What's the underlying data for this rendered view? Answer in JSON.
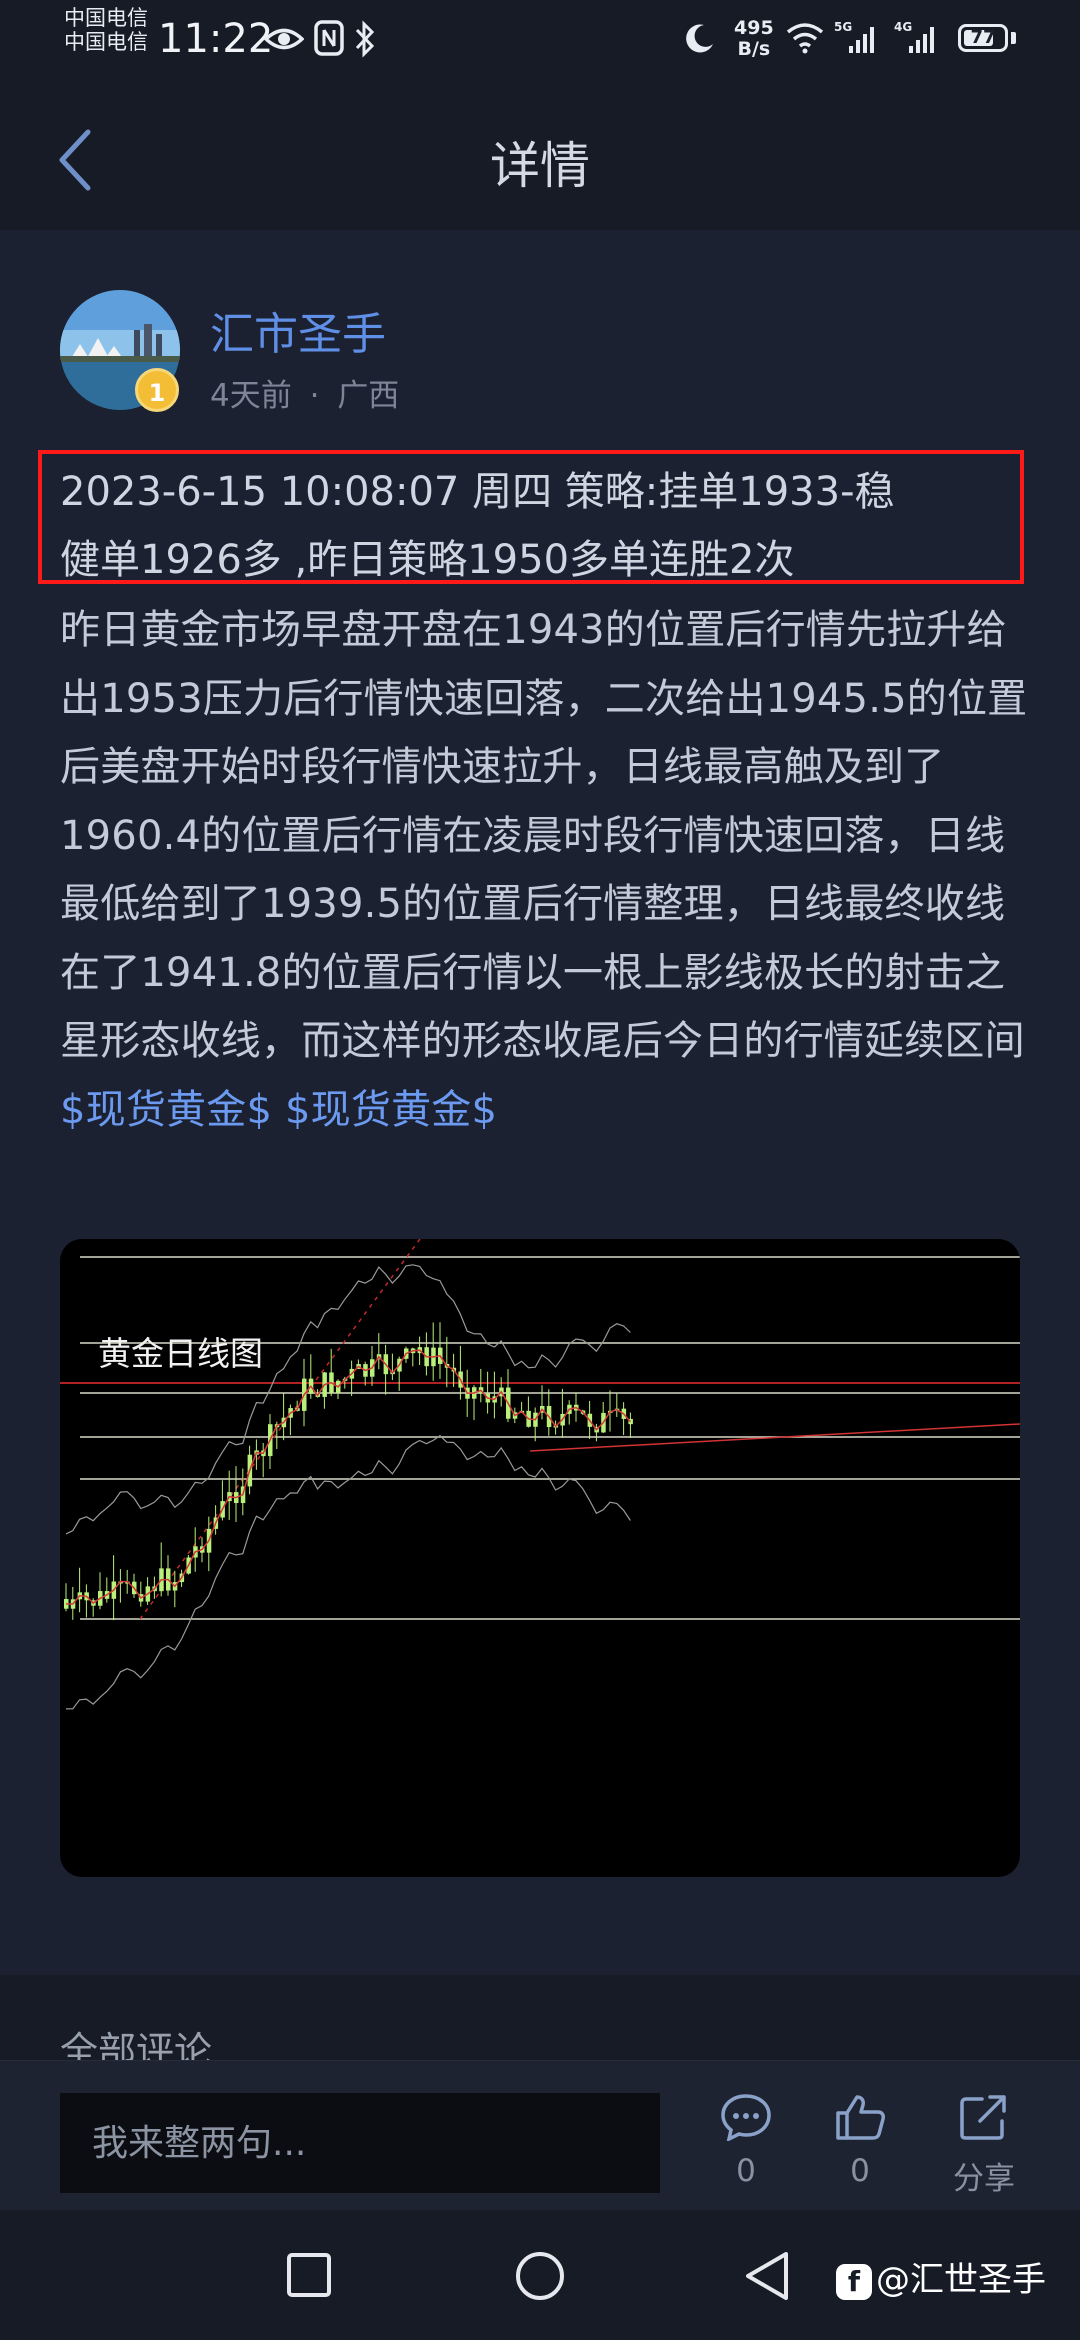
{
  "status_bar": {
    "carrier_1": "中国电信",
    "carrier_2": "中国电信",
    "time": "11:22",
    "net_speed_value": "495",
    "net_speed_unit": "B/s",
    "signal_1_label": "5G",
    "signal_2_label": "4G",
    "battery": "77",
    "battery_level": 0.77,
    "icons": [
      "eye-icon",
      "nfc-icon",
      "bluetooth-icon",
      "moon-icon",
      "wifi-icon",
      "signal-icon",
      "battery-icon"
    ]
  },
  "header": {
    "title": "详情",
    "back_icon": "chevron-left-icon"
  },
  "post": {
    "author": "汇市圣手",
    "level_badge": "1",
    "time_ago": "4天前",
    "separator": "·",
    "location": "广西",
    "headline_line1": "2023-6-15 10:08:07 周四 策略:挂单1933-稳",
    "headline_line2": "健单1926多 ,昨日策略1950多单连胜2次",
    "body_text": "昨日黄金市场早盘开盘在1943的位置后行情先拉升给出1953压力后行情快速回落，二次给出1945.5的位置后美盘开始时段行情快速拉升，日线最高触及到了1960.4的位置后行情在凌晨时段行情快速回落，日线最低给到了1939.5的位置后行情整理，日线最终收线在了1941.8的位置后行情以一根上影线极长的射击之星形态收线，而这样的形态收尾后今日的行情延续区间 ",
    "tag_1": "$现货黄金$",
    "tag_2": "$现货黄金$",
    "chart_caption": "黄金日线图"
  },
  "comments": {
    "title": "全部评论"
  },
  "bottom_bar": {
    "input_placeholder": "我来整两句...",
    "comment_count": "0",
    "like_count": "0",
    "share_label": "分享"
  },
  "watermark": {
    "text": "@汇世圣手"
  },
  "colors": {
    "background": "#161b26",
    "card": "#1b2130",
    "accent_blue": "#5f8fe6",
    "highlight_red": "#ff1a1a",
    "candle_green": "#b8f07a"
  }
}
